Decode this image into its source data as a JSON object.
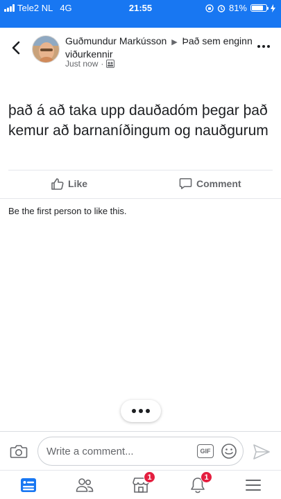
{
  "status_bar": {
    "carrier": "Tele2 NL",
    "network": "4G",
    "time": "21:55",
    "battery_level": 0.81,
    "battery": "81%"
  },
  "header": {
    "author": "Guðmundur Markússon",
    "group": "Það sem enginn viðurkennir",
    "timestamp": "Just now",
    "privacy_icon": "group-icon"
  },
  "post": {
    "text": "það á að taka upp dauðadóm þegar það kemur að barnaníðingum og nauðgurum"
  },
  "actions": {
    "like_label": "Like",
    "comment_label": "Comment"
  },
  "likes": {
    "text": "Be the first person to like this."
  },
  "comment_bar": {
    "placeholder": "Write a comment...",
    "gif_label": "GIF"
  },
  "bottom_nav": {
    "marketplace_badge": "1",
    "notifications_badge": "1"
  },
  "colors": {
    "brand": "#1877f2",
    "badge": "#e41e3f",
    "icon_gray": "#65676b"
  }
}
